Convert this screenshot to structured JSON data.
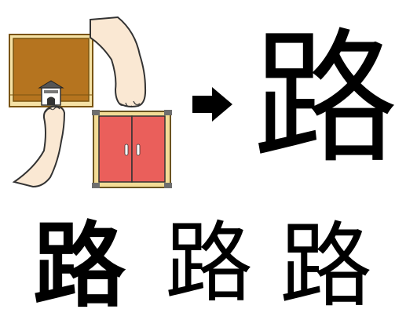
{
  "glyphs": {
    "main": "路",
    "variants": [
      "路",
      "路",
      "路"
    ]
  },
  "icons": {
    "illustration": [
      "city-wall-with-gate-icon",
      "bare-foot-icon",
      "bare-foot-icon",
      "red-double-door-icon"
    ],
    "arrow": "right-arrow-icon"
  },
  "colors": {
    "wall_fill": "#b5741f",
    "wall_trim": "#f5e2a6",
    "door_red": "#ea5f5b",
    "door_frame": "#f3dc96",
    "skin": "#fae8d3"
  }
}
